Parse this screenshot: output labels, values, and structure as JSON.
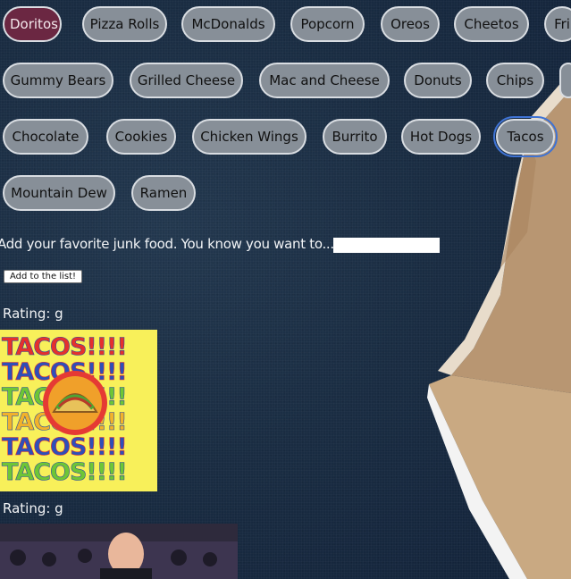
{
  "chips": [
    {
      "label": "Doritos",
      "active": true
    },
    {
      "label": "Pizza Rolls"
    },
    {
      "label": "McDonalds"
    },
    {
      "label": "Popcorn"
    },
    {
      "label": "Oreos"
    },
    {
      "label": "Cheetos"
    },
    {
      "label": "Fri"
    },
    {
      "label": "Gummy Bears"
    },
    {
      "label": "Grilled Cheese"
    },
    {
      "label": "Mac and Cheese"
    },
    {
      "label": "Donuts"
    },
    {
      "label": "Chips"
    },
    {
      "label": ""
    },
    {
      "label": "Chocolate"
    },
    {
      "label": "Cookies"
    },
    {
      "label": "Chicken Wings"
    },
    {
      "label": "Burrito"
    },
    {
      "label": "Hot Dogs"
    },
    {
      "label": "Tacos",
      "focused": true
    },
    {
      "label": "Mountain Dew"
    },
    {
      "label": "Ramen"
    }
  ],
  "form": {
    "prompt": "Add your favorite junk food. You know you want to...",
    "input_value": "",
    "button_label": "Add to the list!"
  },
  "results": [
    {
      "rating": "Rating: g",
      "gif_text": [
        "TACOS!!!!",
        "TACOS!!!!",
        "TACOS!!!!",
        "TACOS!!!!",
        "TACOS!!!!",
        "TACOS!!!!"
      ]
    },
    {
      "rating": "Rating: g"
    }
  ],
  "colors": {
    "active_chip": "#6b2742",
    "chip": "#878f98",
    "background": "#1a2d43"
  }
}
